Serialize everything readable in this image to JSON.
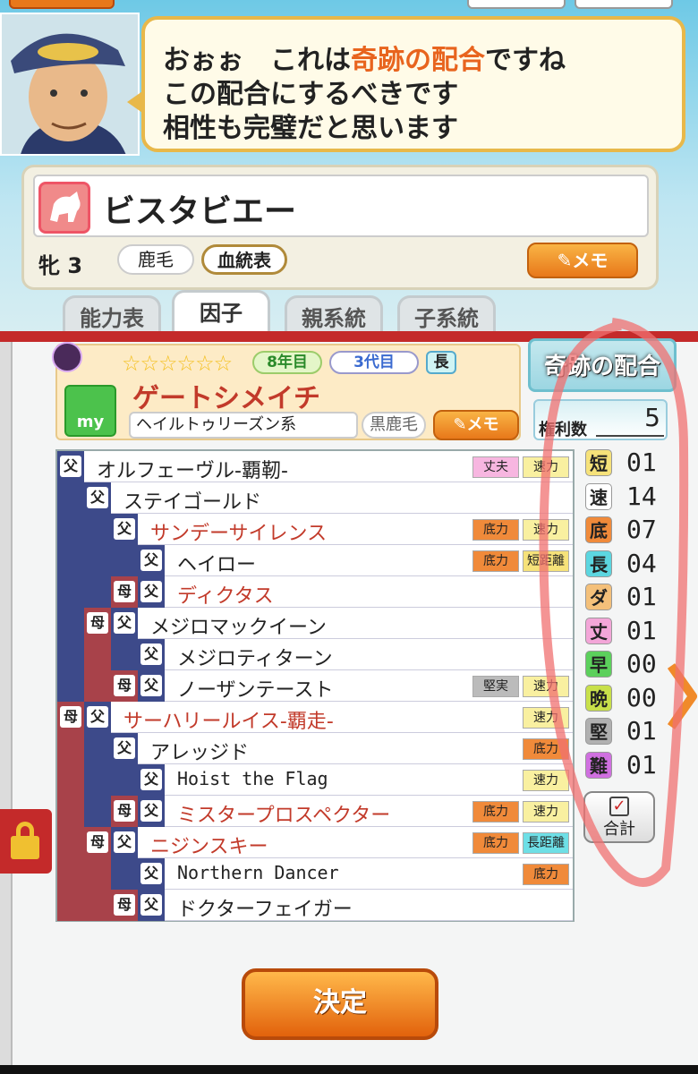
{
  "advisor": {
    "line1_pre": "おぉぉ　これは",
    "line1_hl": "奇跡の配合",
    "line1_post": "ですね",
    "line2": "この配合にするべきです",
    "line3": "相性も完璧だと思います"
  },
  "mare": {
    "name": "ビスタビエー",
    "sex_age": "牝 3",
    "coat": "鹿毛",
    "pedigree_label": "血統表",
    "memo_label": "メモ"
  },
  "tabs": [
    "能力表",
    "因子",
    "親系統",
    "子系統"
  ],
  "stallion": {
    "gen1": "8年目",
    "gen2": "3代目",
    "gen3": "長",
    "name": "ゲートシメイチ",
    "lineage": "ヘイルトゥリーズン系",
    "coat": "黒鹿毛",
    "memo_label": "メモ",
    "my_label": "my",
    "stars": "☆☆☆☆☆☆"
  },
  "badge": {
    "title": "奇跡の配合"
  },
  "rights": {
    "label": "権利数",
    "value": "5"
  },
  "pedigree": [
    {
      "name": "オルフェーヴル-覇靭-",
      "red": false,
      "tags": [
        "丈夫",
        "速力"
      ]
    },
    {
      "name": "ステイゴールド",
      "red": false,
      "tags": []
    },
    {
      "name": "サンデーサイレンス",
      "red": true,
      "tags": [
        "底力",
        "速力"
      ]
    },
    {
      "name": "ヘイロー",
      "red": false,
      "tags": [
        "底力",
        "短距離"
      ]
    },
    {
      "name": "ディクタス",
      "red": true,
      "tags": []
    },
    {
      "name": "メジロマックイーン",
      "red": false,
      "tags": []
    },
    {
      "name": "メジロティターン",
      "red": false,
      "tags": []
    },
    {
      "name": "ノーザンテースト",
      "red": false,
      "tags": [
        "堅実",
        "速力"
      ]
    },
    {
      "name": "サーハリールイス-覇走-",
      "red": true,
      "tags": [
        "速力"
      ]
    },
    {
      "name": "アレッジド",
      "red": false,
      "tags": [
        "底力"
      ]
    },
    {
      "name": "Hoist the Flag",
      "red": false,
      "tags": [
        "速力"
      ]
    },
    {
      "name": "ミスタープロスペクター",
      "red": true,
      "tags": [
        "底力",
        "速力"
      ]
    },
    {
      "name": "ニジンスキー",
      "red": true,
      "tags": [
        "底力",
        "長距離"
      ]
    },
    {
      "name": "Northern Dancer",
      "red": false,
      "tags": [
        "底力"
      ]
    },
    {
      "name": "ドクターフェイガー",
      "red": false,
      "tags": []
    }
  ],
  "labels": {
    "father": "父",
    "mother": "母"
  },
  "stats": [
    {
      "label": "短",
      "value": "01",
      "color": "#f6e27a"
    },
    {
      "label": "速",
      "value": "14",
      "color": "#ffffff"
    },
    {
      "label": "底",
      "value": "07",
      "color": "#f08a3a"
    },
    {
      "label": "長",
      "value": "04",
      "color": "#5cd6e0"
    },
    {
      "label": "ダ",
      "value": "01",
      "color": "#f4c07a"
    },
    {
      "label": "丈",
      "value": "01",
      "color": "#f3a6d8"
    },
    {
      "label": "早",
      "value": "00",
      "color": "#5cd05c"
    },
    {
      "label": "晩",
      "value": "00",
      "color": "#c8e04a"
    },
    {
      "label": "堅",
      "value": "01",
      "color": "#b0b0b0"
    },
    {
      "label": "難",
      "value": "01",
      "color": "#d070e0"
    }
  ],
  "sum_label": "合計",
  "decide_label": "決定",
  "colors": {
    "accent": "#e8641e",
    "red_bar": "#c42a2a",
    "sire_block": "#3d4a8a",
    "dam_block": "#a8424a"
  }
}
